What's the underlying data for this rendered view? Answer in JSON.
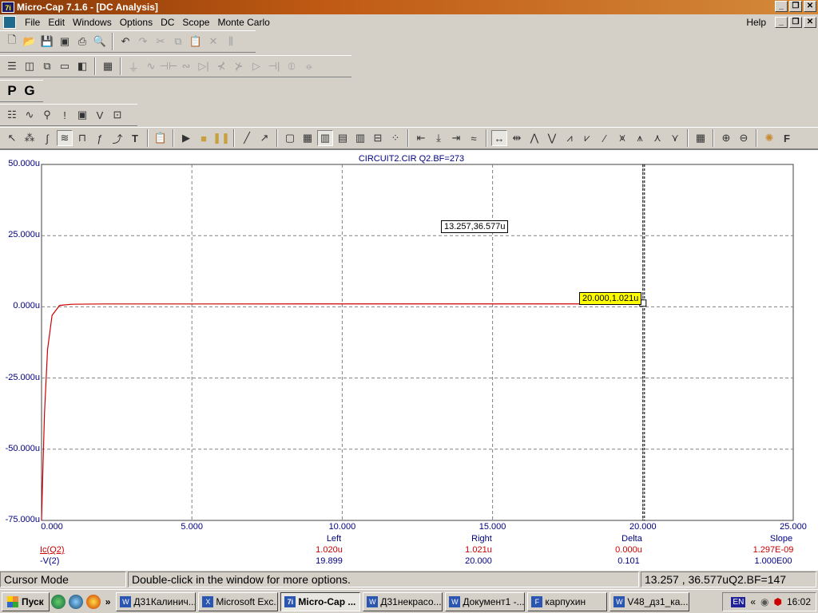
{
  "window": {
    "title": "Micro-Cap 7.1.6 - [DC Analysis]",
    "app_icon": "7i"
  },
  "menu": {
    "items": [
      "File",
      "Edit",
      "Windows",
      "Options",
      "DC",
      "Scope",
      "Monte Carlo"
    ],
    "help": "Help"
  },
  "toolbar_pg": {
    "p": "P",
    "g": "G"
  },
  "plot": {
    "title": "CIRCUIT2.CIR Q2.BF=273",
    "y_ticks": [
      "50.000u",
      "25.000u",
      "0.000u",
      "-25.000u",
      "-50.000u",
      "-75.000u"
    ],
    "x_ticks": [
      "0.000",
      "5.000",
      "10.000",
      "15.000",
      "20.000",
      "25.000"
    ],
    "tooltip_cursor": "13.257,36.577u",
    "tooltip_point": "20.000,1.021u",
    "trace_color": "#cc0000"
  },
  "chart_data": {
    "type": "line",
    "title": "CIRCUIT2.CIR Q2.BF=273",
    "xlim": [
      0,
      25
    ],
    "ylim": [
      -75,
      50
    ],
    "y_unit": "u",
    "grid": true,
    "series": [
      {
        "name": "Ic(Q2)",
        "color": "#cc0000",
        "x": [
          0,
          0.05,
          0.1,
          0.2,
          0.35,
          0.6,
          1.0,
          2.0,
          5.0,
          10.0,
          15.0,
          20.0
        ],
        "y": [
          -75,
          -55,
          -37,
          -15,
          -3,
          0.5,
          0.9,
          1.0,
          1.01,
          1.015,
          1.018,
          1.021
        ]
      }
    ]
  },
  "readout": {
    "headers": {
      "left": "Left",
      "right": "Right",
      "delta": "Delta",
      "slope": "Slope"
    },
    "rows": [
      {
        "label": "Ic(Q2)",
        "left": "1.020u",
        "right": "1.021u",
        "delta": "0.000u",
        "slope": "1.297E-09",
        "color": "#cc0000"
      },
      {
        "label": "-V(2)",
        "left": "19.899",
        "right": "20.000",
        "delta": "0.101",
        "slope": "1.000E00",
        "color": "#000080"
      }
    ]
  },
  "status": {
    "mode": "Cursor Mode",
    "hint": "Double-click in the window for more options.",
    "coords": "13.257 , 36.577uQ2.BF=147"
  },
  "taskbar": {
    "start": "Пуск",
    "tasks": [
      {
        "label": "Д31Калинич...",
        "icon": "W"
      },
      {
        "label": "Microsoft Exc...",
        "icon": "X"
      },
      {
        "label": "Micro-Cap ...",
        "icon": "7i",
        "active": true
      },
      {
        "label": "Д31некрасо...",
        "icon": "W"
      },
      {
        "label": "Документ1 -...",
        "icon": "W"
      },
      {
        "label": "карпухин",
        "icon": "F"
      },
      {
        "label": "V48_дз1_ка...",
        "icon": "W"
      }
    ],
    "lang": "EN",
    "time": "16:02"
  }
}
